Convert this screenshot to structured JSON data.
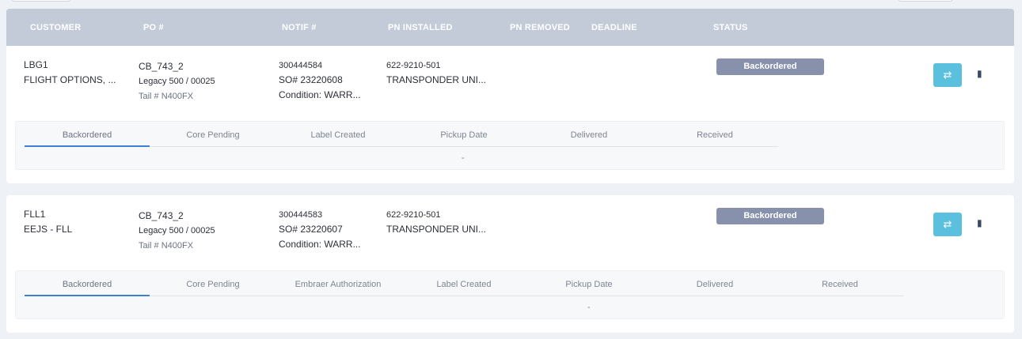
{
  "columns": [
    "CUSTOMER",
    "PO #",
    "NOTIF #",
    "PN INSTALLED",
    "PN REMOVED",
    "DEADLINE",
    "STATUS"
  ],
  "orders": [
    {
      "customer_code": "LBG1",
      "customer_name": "FLIGHT OPTIONS, ...",
      "po": "CB_743_2",
      "aircraft": "Legacy 500 / 00025",
      "tail": "Tail # N400FX",
      "notif": "300444584",
      "so": "SO# 23220608",
      "condition": "Condition: WARR...",
      "pn_installed": "622-9210-501",
      "pn_desc": "TRANSPONDER UNI...",
      "status": "Backordered",
      "steps": [
        "Backordered",
        "Core Pending",
        "Label Created",
        "Pickup Date",
        "Delivered",
        "Received"
      ],
      "active_step": "Backordered",
      "step_detail": "-"
    },
    {
      "customer_code": "FLL1",
      "customer_name": "EEJS - FLL",
      "po": "CB_743_2",
      "aircraft": "Legacy 500 / 00025",
      "tail": "Tail # N400FX",
      "notif": "300444583",
      "so": "SO# 23220607",
      "condition": "Condition: WARR...",
      "pn_installed": "622-9210-501",
      "pn_desc": "TRANSPONDER UNI...",
      "status": "Backordered",
      "steps": [
        "Backordered",
        "Core Pending",
        "Embraer Authorization",
        "Label Created",
        "Pickup Date",
        "Delivered",
        "Received"
      ],
      "active_step": "Backordered",
      "step_detail": "-"
    }
  ],
  "icons": {
    "sync": "sync-icon",
    "book": "book-icon"
  },
  "colors": {
    "header": "#c3cbd9",
    "status_badge": "#8791ab",
    "sync_button": "#5bc0de",
    "active_tab": "#3b82d6"
  }
}
